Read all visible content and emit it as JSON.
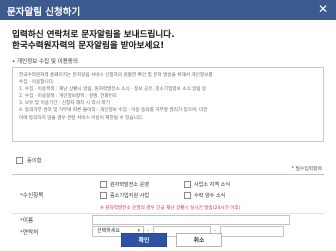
{
  "window": {
    "title": "문자알림 신청하기",
    "close_glyph": "✕"
  },
  "heading": {
    "line1": "입력하신 연락처로 문자알림을 보내드립니다.",
    "line2": "한국수력원자력의 문자알림을 받아보세요!"
  },
  "consent": {
    "title": "• 개인정보 수집 및 이용동의",
    "body_lines": [
      "한국수력원자력 홈페이지는 문자알림 서비스 신청자의 원활한 확인 및 문자 발송을 위해서 개인정보를",
      "수집 · 이용합니다.",
      "1. 수집 · 이용목적 : 재난 상황시 알림, 원자력발전소 소식 · 정보 공유, 중소기업정보 소식 알림 등",
      "2. 수집 · 이용항목 : 개인정보항목 : 성명, 전화번호",
      "3. 보유 및 이용기간 : 신청자 해지 시 즉시 파기",
      "4. 동의거부 권리 및 거부에 따른 불이익 : 개인정보 수집 · 이용 동의를 거부할 권리가 있으며, 다만",
      "   이에 동의하지 않을 경우 관련 서비스 이용이 제한될 수 있습니다."
    ],
    "agree_label": "동의함"
  },
  "form": {
    "required_note": "* 필수입력항목",
    "subscribe": {
      "label": "수신항목",
      "options": [
        "원자력발전소 운영",
        "중소기업지원 사업",
        "사업소 지역 소식",
        "수력 양수 소식"
      ],
      "warning": "※ 원자력발전소 운영의 경우 긴급 재난 상황시 실시간 발송(24시간 이후)"
    },
    "name": {
      "label": "이름"
    },
    "phone": {
      "label": "연락처",
      "select_value": "선택하세요",
      "separator": "-"
    },
    "required_mark": "*"
  },
  "buttons": {
    "confirm": "확인",
    "cancel": "취소"
  },
  "colors": {
    "titlebar": "#3b5a8e",
    "primary_button": "#2f52a4",
    "warning_text": "#e02e2e"
  }
}
